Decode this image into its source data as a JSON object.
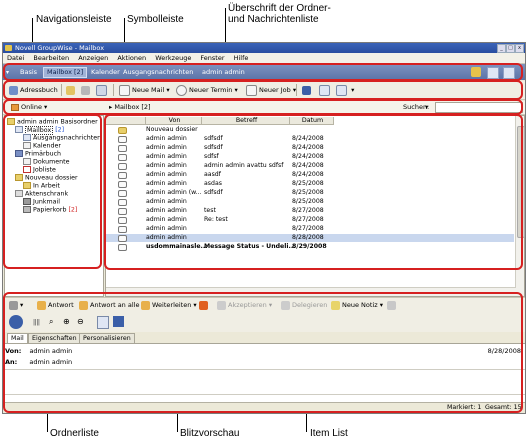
{
  "callouts": {
    "nav": "Navigationsleiste",
    "toolbar": "Symbolleiste",
    "header_line1": "Überschrift der Ordner-",
    "header_line2": "und Nachrichtenliste",
    "folderlist": "Ordnerliste",
    "preview": "Blitzvorschau",
    "itemlist": "Item List"
  },
  "window": {
    "title": "Novell GroupWise - Mailbox",
    "title_btns": [
      "_",
      "□",
      "x"
    ]
  },
  "menu": [
    "Datei",
    "Bearbeiten",
    "Anzeigen",
    "Aktionen",
    "Werkzeuge",
    "Fenster",
    "Hilfe"
  ],
  "nav_tabs": [
    "Basis",
    "Mailbox [2]",
    "Kalender",
    "Ausgangsnachrichten",
    "admin admin"
  ],
  "toolbar": {
    "adressbuch": "Adressbuch",
    "neue_mail": "Neue Mail",
    "neuer_termin": "Neuer Termin",
    "neuer_job": "Neuer Job"
  },
  "location": {
    "online": "Online",
    "mailbox": "Mailbox [2]",
    "suchen": "Suchen:"
  },
  "folders": [
    {
      "label": "admin admin Basisordner",
      "count": ""
    },
    {
      "label": "Mailbox",
      "count": "[2]"
    },
    {
      "label": "Ausgangsnachrichten",
      "count": ""
    },
    {
      "label": "Kalender",
      "count": ""
    },
    {
      "label": "Primärbuch",
      "count": ""
    },
    {
      "label": "Dokumente",
      "count": ""
    },
    {
      "label": "Jobliste",
      "count": ""
    },
    {
      "label": "Nouveau dossier",
      "count": ""
    },
    {
      "label": "In Arbeit",
      "count": ""
    },
    {
      "label": "Aktenschrank",
      "count": ""
    },
    {
      "label": "Junkmail",
      "count": ""
    },
    {
      "label": "Papierkorb",
      "count": "[2]"
    }
  ],
  "columns": {
    "von": "Von",
    "betreff": "Betreff",
    "datum": "Datum"
  },
  "items": [
    {
      "von": "Nouveau dossier",
      "betreff": "",
      "datum": ""
    },
    {
      "von": "admin admin",
      "betreff": "sdfsdf",
      "datum": "8/24/2008"
    },
    {
      "von": "admin admin",
      "betreff": "sdfsdf",
      "datum": "8/24/2008"
    },
    {
      "von": "admin admin",
      "betreff": "sdfsf",
      "datum": "8/24/2008"
    },
    {
      "von": "admin admin",
      "betreff": "admin admin avattu sdfsf",
      "datum": "8/24/2008"
    },
    {
      "von": "admin admin",
      "betreff": "aasdf",
      "datum": "8/24/2008"
    },
    {
      "von": "admin admin",
      "betreff": "asdas",
      "datum": "8/25/2008"
    },
    {
      "von": "admin admin (w...",
      "betreff": "sdfsdf",
      "datum": "8/25/2008"
    },
    {
      "von": "admin admin",
      "betreff": "",
      "datum": "8/25/2008"
    },
    {
      "von": "admin admin",
      "betreff": "test",
      "datum": "8/27/2008"
    },
    {
      "von": "admin admin",
      "betreff": "Re: test",
      "datum": "8/27/2008"
    },
    {
      "von": "admin admin",
      "betreff": "",
      "datum": "8/27/2008"
    },
    {
      "von": "admin admin",
      "betreff": "",
      "datum": "8/28/2008"
    },
    {
      "von": "usdommainasle...",
      "betreff": "Message Status - Undeli...",
      "datum": "8/29/2008"
    }
  ],
  "actions": [
    "Antwort",
    "Antwort an alle",
    "Weiterleiten",
    "Akzeptieren",
    "Delegieren",
    "Neue Notiz"
  ],
  "preview_tabs": [
    "Mail",
    "Eigenschaften",
    "Personalisieren"
  ],
  "preview": {
    "von_label": "Von:",
    "von": "admin admin",
    "date": "8/28/2008",
    "an_label": "An:",
    "an": "admin admin"
  },
  "status": {
    "markiert": "Markiert: 1",
    "gesamt": "Gesamt: 15"
  },
  "colors": {
    "highlight": "#d62020",
    "selected_row": "#c9d7ee",
    "nav_bg": "#5a73a8"
  }
}
